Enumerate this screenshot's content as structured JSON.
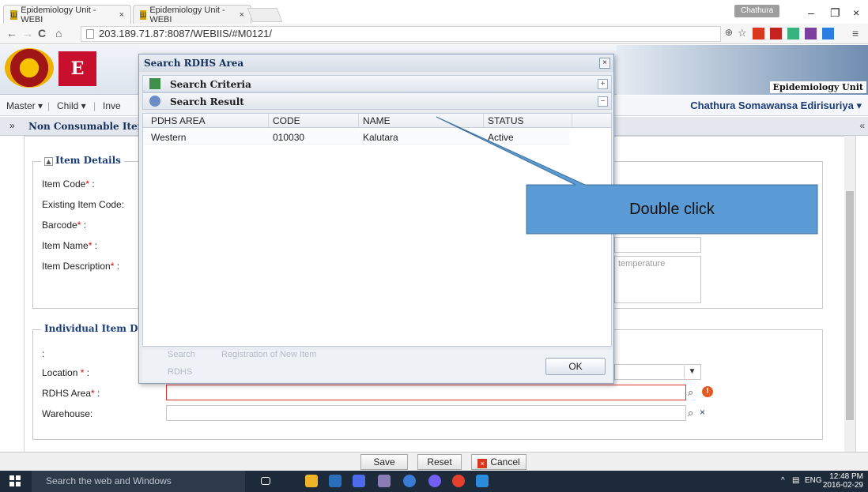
{
  "browser": {
    "tabs": [
      {
        "title": "Epidemiology Unit - WEBI",
        "close": "×"
      },
      {
        "title": "Epidemiology Unit - WEBI",
        "close": "×"
      }
    ],
    "profile": "Chathura",
    "url": "203.189.71.87:8087/WEBIIS/#M0121/",
    "controls": {
      "minimize": "–",
      "maximize": "❐",
      "close": "×"
    }
  },
  "header": {
    "org_label": "Epidemiology Unit"
  },
  "menu": {
    "items": [
      "Master ▾",
      "Child ▾",
      "Inve"
    ],
    "user": "Chathura Somawansa Edirisuriya ▾"
  },
  "page_tab": {
    "title": "Non Consumable Items"
  },
  "form": {
    "item_details_legend": "Item Details",
    "item_code_label": "Item Code",
    "existing_item_code_label": "Existing Item Code:",
    "barcode_label": "Barcode",
    "item_name_label": "Item Name",
    "item_description_label": "Item Description",
    "item_description_value": "temperature",
    "individual_legend": "Individual Item Detai",
    "colon_label": ":",
    "location_label": "Location",
    "rdhs_area_label": "RDHS Area",
    "warehouse_label": "Warehouse:",
    "radio_search": "Search",
    "radio_new": "Registration of New Item",
    "location_value": "RDHS"
  },
  "buttons": {
    "save": "Save",
    "reset": "Reset",
    "cancel": "Cancel"
  },
  "dialog": {
    "title": "Search RDHS Area",
    "close": "×",
    "search_criteria": "Search Criteria",
    "search_result": "Search Result",
    "ok": "OK",
    "columns": [
      "PDHS AREA",
      "CODE",
      "NAME",
      "STATUS"
    ],
    "rows": [
      {
        "area": "Western",
        "code": "010030",
        "name": "Kalutara",
        "status": "Active"
      }
    ]
  },
  "callout": {
    "text": "Double click",
    "color": "#5b9bd5"
  },
  "taskbar": {
    "search_placeholder": "Search the web and Windows",
    "tray_lang": "ENG",
    "time": "12:48 PM",
    "date": "2016-02-29"
  }
}
